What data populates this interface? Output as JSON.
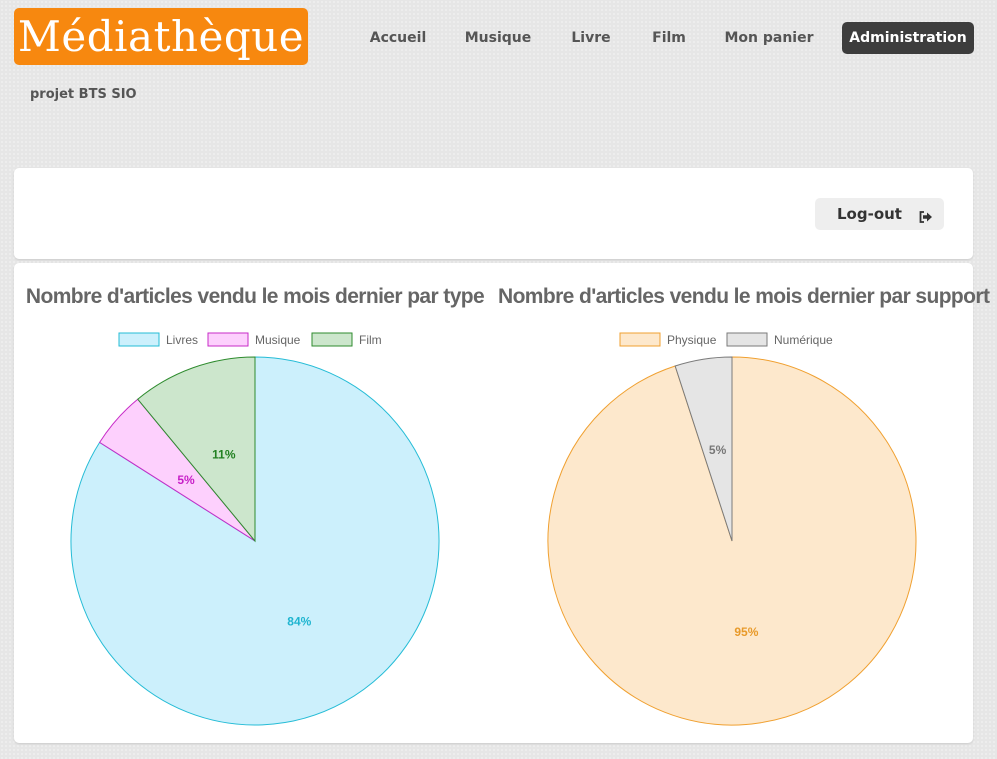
{
  "brand": {
    "logo_text": "Médiathèque",
    "subtitle": "projet BTS SIO",
    "color": "#f7880f"
  },
  "nav": {
    "items": [
      {
        "label": "Accueil"
      },
      {
        "label": "Musique"
      },
      {
        "label": "Livre"
      },
      {
        "label": "Film"
      },
      {
        "label": "Mon panier"
      },
      {
        "label": "Administration",
        "active": true
      }
    ]
  },
  "logout": {
    "label": "Log-out",
    "icon": "sign-out-icon"
  },
  "chart_data": [
    {
      "type": "pie",
      "title": "Nombre d'articles vendu le mois dernier par type",
      "legend_position": "top",
      "categories": [
        "Livres",
        "Musique",
        "Film"
      ],
      "values": [
        84,
        5,
        11
      ],
      "labels": [
        "84%",
        "5%",
        "11%"
      ],
      "colors": {
        "fill": [
          "#ccf0fc",
          "#fdd0fd",
          "#cce6cc"
        ],
        "stroke": [
          "#25bcd6",
          "#c72bc7",
          "#2e8b2e"
        ],
        "label": [
          "#1fb5d0",
          "#c71fc7",
          "#218021"
        ]
      }
    },
    {
      "type": "pie",
      "title": "Nombre d'articles vendu le mois dernier par support",
      "legend_position": "top",
      "categories": [
        "Physique",
        "Numérique"
      ],
      "values": [
        95,
        5
      ],
      "labels": [
        "95%",
        "5%"
      ],
      "colors": {
        "fill": [
          "#fde8cc",
          "#e5e5e5"
        ],
        "stroke": [
          "#f0a030",
          "#7a7a7a"
        ],
        "label": [
          "#e89a2a",
          "#777777"
        ]
      }
    }
  ]
}
